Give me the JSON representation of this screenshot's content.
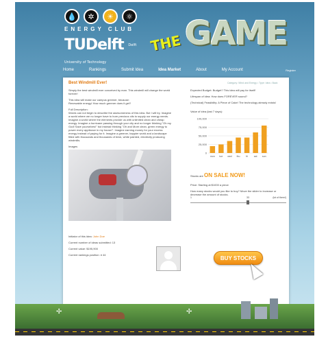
{
  "header": {
    "club_name": "ENERGY CLUB",
    "icons": [
      "water-drop-icon",
      "wind-icon",
      "sun-icon",
      "atom-icon"
    ],
    "university": "TUDelft",
    "university_sub": "Delft University of Technology",
    "game_prefix": "THE",
    "game_title": "GAME"
  },
  "nav": {
    "items": [
      "Home",
      "Rankings",
      "Submit Idea",
      "Idea Market",
      "About",
      "My Account"
    ],
    "active": "Idea Market",
    "register": "Register"
  },
  "breadcrumb": "Category: Wind and Energy  •  Type: Idea  •  Back",
  "idea": {
    "title": "Best Windmill Ever!",
    "intro": "Simply the best windmill ever conceived by man. This windmill will change the world forever!",
    "tagline": "This idea will make our campus greener, because:\nRenewable energy! How much greener does it get?",
    "full_description_label": "Full Description:",
    "full_description": "Words can not begin to describe the awesomeness of this idea. But I will try. Imagine a world where we no longer have to burn precious oils to supply our energy needs. Imagine a world where the elements provide us with unlimited clean and cheap energy. Imagine a hurricane passing through your city and no longer thinking \"Oh my God! Save yourselves!\" but instead thinking \"Oh and More clean, green energy to power every appliance in my house!\". Imagine earning money for your excess energy instead of paying for it. Imagine a greener, happier world and a landscape filled with thousands and thousands of brick, white painted, electricity producing windmills.",
    "images_label": "Images"
  },
  "initiator": {
    "label": "Initiator of this idea:",
    "name": "John Doe",
    "ideas_submitted": "Current number of ideas submitted: 13",
    "value": "Current value: $195,900",
    "ranking": "Current rankings position: # 44"
  },
  "right": {
    "budget": "Expected Budget: Budget? This idea will pay for itself!",
    "lifespan": "Lifespan of idea: How does FOREVER sound?",
    "feasibility": "(Technical) Feasibility: A Piece of Cake! The technology already exists!",
    "value_label": "Value of idea (last 7 days):",
    "stocks_label": "Stocks are",
    "stocks_status": "ON SALE NOW!",
    "price": "Price: Starting at $1000 a piece",
    "slider_question": "How many stocks would you like to buy? Move the slider to increase or decrease the amount of stocks.",
    "slider_min": "1",
    "slider_value": "33",
    "slider_max_label": "(lot of them!)",
    "buy_button": "BUY STOCKS"
  },
  "chart_data": {
    "type": "bar",
    "categories": [
      "mon",
      "tue",
      "wed",
      "thu",
      "fri",
      "sat",
      "sun"
    ],
    "values": [
      20000,
      25000,
      35000,
      45000,
      45000,
      60000,
      80000
    ],
    "ylim": [
      0,
      100000
    ],
    "yticks": [
      "100,000",
      "75,000",
      "50,000",
      "25,000",
      "0"
    ],
    "bar_color": "#f0a020"
  },
  "colors": {
    "accent": "#e07a12",
    "sky": "#6ea8c8"
  }
}
